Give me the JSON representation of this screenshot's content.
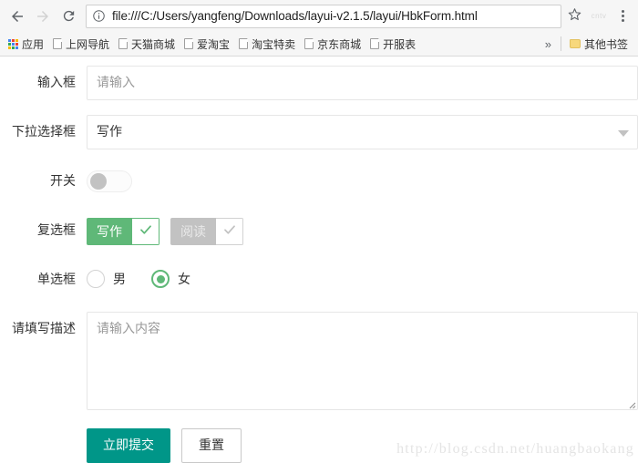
{
  "browser": {
    "back_label": "Back",
    "forward_label": "Forward",
    "reload_label": "Reload",
    "url": "file:///C:/Users/yangfeng/Downloads/layui-v2.1.5/layui/HbkForm.html",
    "site_info_icon": "info-circle-icon",
    "bookmark_star_icon": "star-icon",
    "extension_label": "cntv",
    "menu_icon": "three-dot-menu-icon",
    "bookmarks": [
      {
        "label": "应用",
        "icon": "apps-grid-icon"
      },
      {
        "label": "上网导航",
        "icon": "page-icon"
      },
      {
        "label": "天猫商城",
        "icon": "page-icon"
      },
      {
        "label": "爱淘宝",
        "icon": "page-icon"
      },
      {
        "label": "淘宝特卖",
        "icon": "page-icon"
      },
      {
        "label": "京东商城",
        "icon": "page-icon"
      },
      {
        "label": "开服表",
        "icon": "page-icon"
      }
    ],
    "overflow_label": "»",
    "other_bookmarks": {
      "label": "其他书签",
      "icon": "folder-icon"
    }
  },
  "form": {
    "input": {
      "label": "输入框",
      "value": "",
      "placeholder": "请输入"
    },
    "select": {
      "label": "下拉选择框",
      "value": "写作",
      "options": [
        "写作"
      ],
      "arrow_icon": "chevron-down-icon"
    },
    "switch": {
      "label": "开关",
      "state": "off"
    },
    "checkbox": {
      "label": "复选框",
      "items": [
        {
          "text": "写作",
          "checked": true,
          "disabled": false
        },
        {
          "text": "阅读",
          "checked": true,
          "disabled": true
        }
      ],
      "check_icon": "check-icon"
    },
    "radio": {
      "label": "单选框",
      "items": [
        {
          "text": "男",
          "checked": false
        },
        {
          "text": "女",
          "checked": true
        }
      ]
    },
    "textarea": {
      "label": "请填写描述",
      "value": "",
      "placeholder": "请输入内容"
    },
    "buttons": {
      "submit": "立即提交",
      "reset": "重置"
    }
  },
  "watermark": "http://blog.csdn.net/huangbaokang",
  "colors": {
    "primary": "#009688",
    "checkbox_green": "#5FB878",
    "disabled_gray": "#c2c2c2",
    "border": "#e6e6e6"
  }
}
